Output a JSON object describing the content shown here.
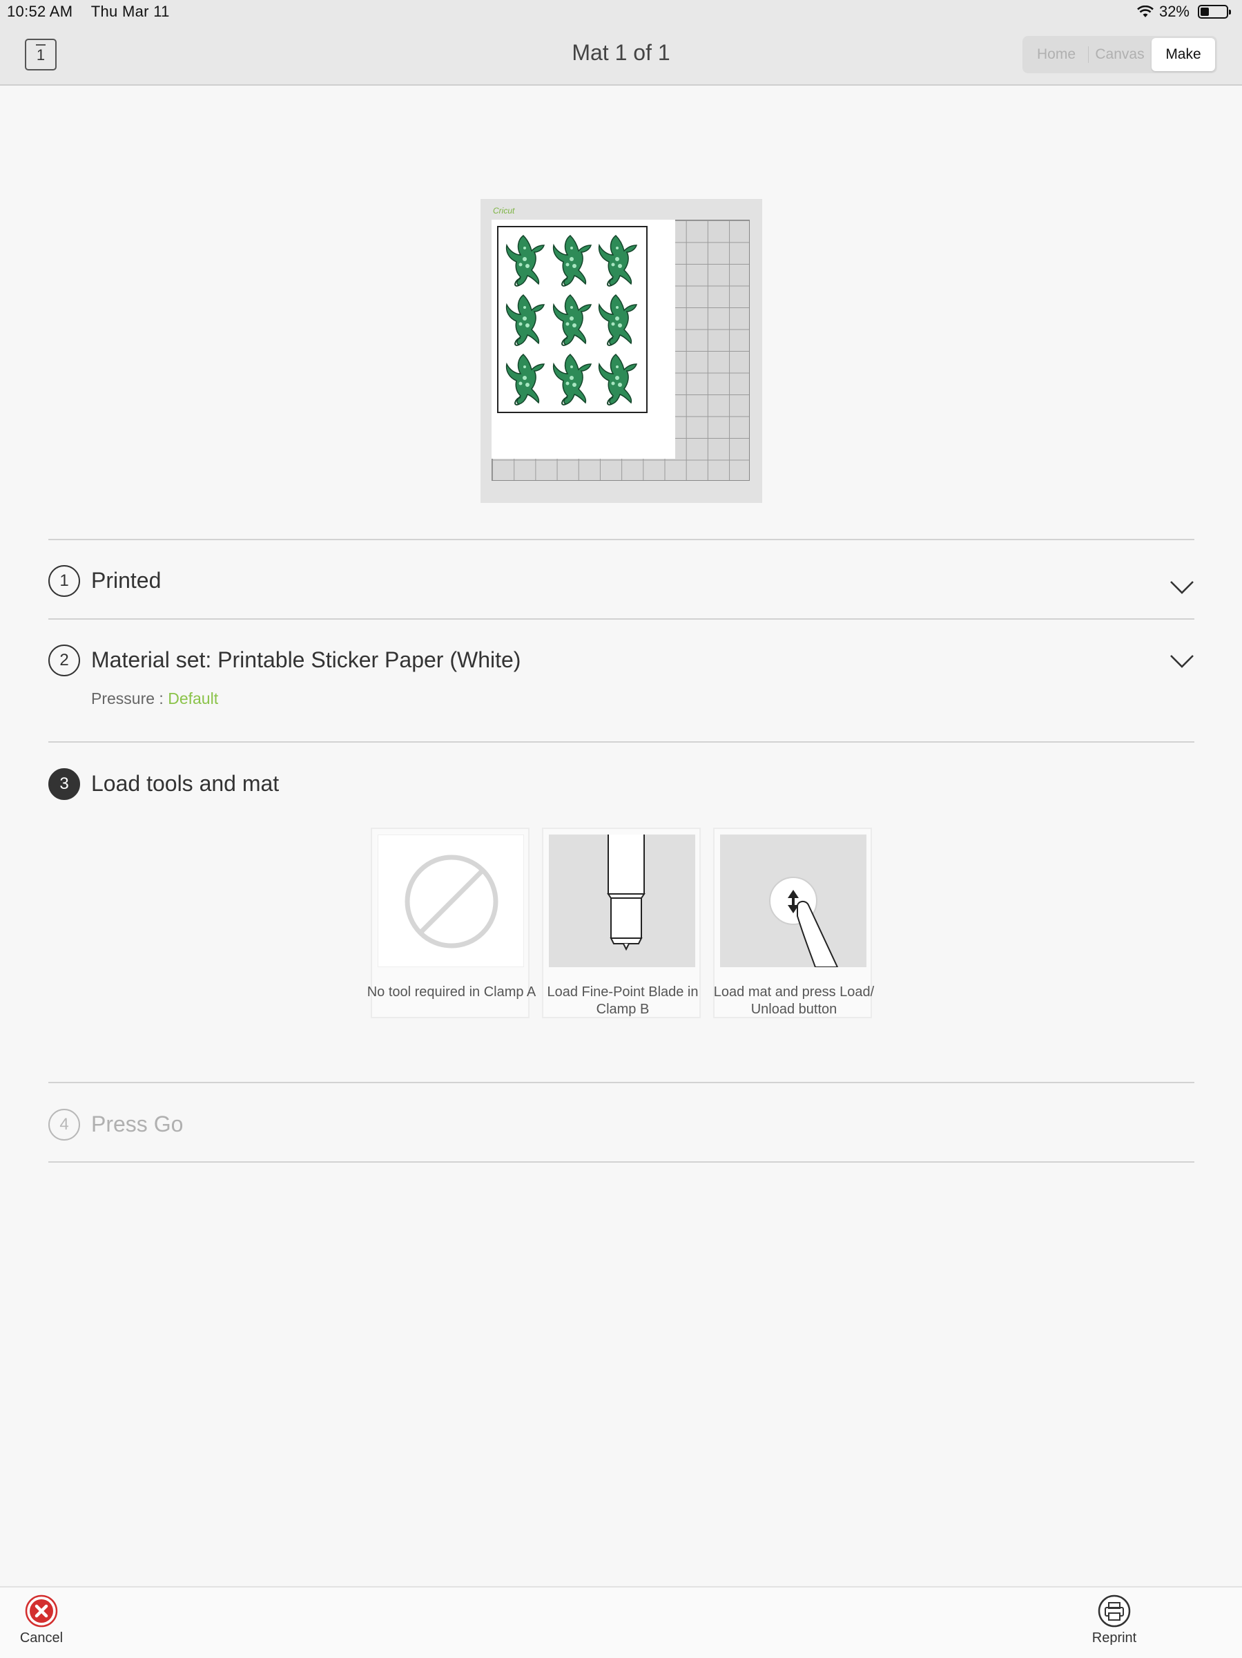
{
  "status_bar": {
    "time": "10:52 AM",
    "date": "Thu Mar 11",
    "battery": "32%"
  },
  "header": {
    "mat_count": "1",
    "title": "Mat 1 of 1",
    "tabs": [
      {
        "label": "Home",
        "active": false
      },
      {
        "label": "Canvas",
        "active": false
      },
      {
        "label": "Make",
        "active": true
      }
    ]
  },
  "mat_preview": {
    "brand": "Cricut",
    "design_count": 9
  },
  "steps": [
    {
      "number": "1",
      "title": "Printed",
      "state": "done"
    },
    {
      "number": "2",
      "title": "Material set: Printable Sticker Paper (White)",
      "state": "done",
      "pressure_label": "Pressure :",
      "pressure_value": "Default"
    },
    {
      "number": "3",
      "title": "Load tools and mat",
      "state": "current"
    },
    {
      "number": "4",
      "title": "Press Go",
      "state": "pending"
    }
  ],
  "tools": [
    {
      "caption": "No tool required in Clamp A",
      "icon": "no-tool-icon"
    },
    {
      "caption": "Load Fine-Point Blade in Clamp B",
      "icon": "fine-point-blade-icon"
    },
    {
      "caption": "Load mat and press Load/ Unload button",
      "icon": "load-unload-button-icon"
    }
  ],
  "bottom_bar": {
    "cancel_label": "Cancel",
    "reprint_label": "Reprint"
  },
  "colors": {
    "accent_green": "#8bc34a",
    "cancel_red": "#d32f2f",
    "turtle_green": "#2e8b57"
  }
}
